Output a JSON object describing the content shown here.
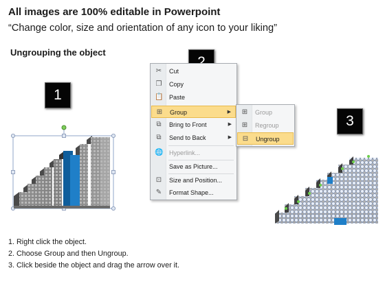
{
  "header": {
    "title": "All images are 100% editable in Powerpoint",
    "subtitle": "“Change color, size and orientation of any icon to your liking”"
  },
  "section_title": "Ungrouping the object",
  "badges": [
    "1",
    "2",
    "3"
  ],
  "context_menu": {
    "items": [
      {
        "label": "Cut",
        "icon": "scissors-icon",
        "enabled": true,
        "submenu": false
      },
      {
        "label": "Copy",
        "icon": "copy-icon",
        "enabled": true,
        "submenu": false
      },
      {
        "label": "Paste",
        "icon": "paste-icon",
        "enabled": true,
        "submenu": false
      },
      {
        "label": "Group",
        "icon": "group-icon",
        "enabled": true,
        "submenu": true,
        "highlighted": true
      },
      {
        "label": "Bring to Front",
        "icon": "bring-to-front-icon",
        "enabled": true,
        "submenu": true
      },
      {
        "label": "Send to Back",
        "icon": "send-to-back-icon",
        "enabled": true,
        "submenu": true
      },
      {
        "label": "Hyperlink...",
        "icon": "hyperlink-icon",
        "enabled": false,
        "submenu": false
      },
      {
        "label": "Save as Picture...",
        "icon": "",
        "enabled": true,
        "submenu": false
      },
      {
        "label": "Size and Position...",
        "icon": "size-position-icon",
        "enabled": true,
        "submenu": false
      },
      {
        "label": "Format Shape...",
        "icon": "format-shape-icon",
        "enabled": true,
        "submenu": false
      }
    ]
  },
  "submenu": {
    "items": [
      {
        "label": "Group",
        "icon": "group-icon",
        "enabled": false
      },
      {
        "label": "Regroup",
        "icon": "regroup-icon",
        "enabled": false
      },
      {
        "label": "Ungroup",
        "icon": "ungroup-icon",
        "enabled": true,
        "highlighted": true
      }
    ]
  },
  "instructions": [
    "1.  Right click the object.",
    "2.  Choose Group and then Ungroup.",
    "3.  Click beside the object and drag the arrow over it."
  ],
  "colors": {
    "accent_blue": "#1f7fc8",
    "menu_highlight": "#fbdc8c",
    "block_gray": "#8e8e8e"
  }
}
